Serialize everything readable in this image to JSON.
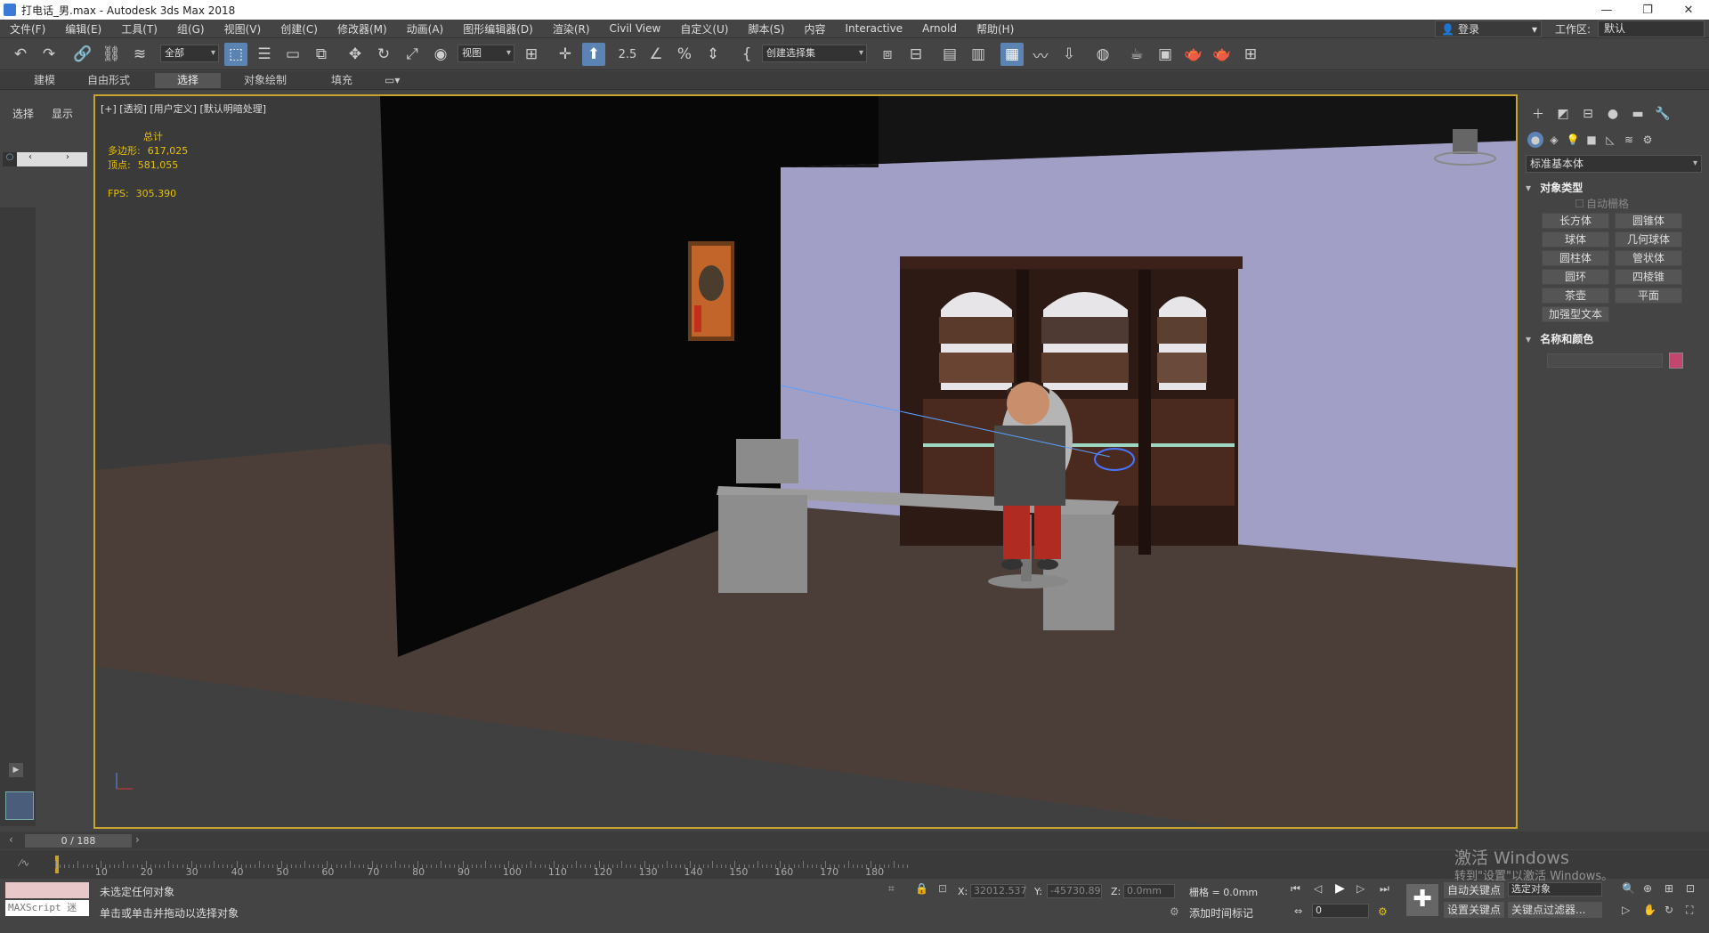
{
  "window": {
    "title": "打电话_男.max - Autodesk 3ds Max 2018",
    "minimize_icon": "minimize-icon",
    "restore_icon": "restore-icon",
    "close_icon": "close-icon"
  },
  "menubar": {
    "items": [
      "文件(F)",
      "编辑(E)",
      "工具(T)",
      "组(G)",
      "视图(V)",
      "创建(C)",
      "修改器(M)",
      "动画(A)",
      "图形编辑器(D)",
      "渲染(R)",
      "Civil View",
      "自定义(U)",
      "脚本(S)",
      "内容",
      "Interactive",
      "Arnold",
      "帮助(H)"
    ],
    "login": "登录",
    "workspace_label": "工作区:",
    "workspace_value": "默认"
  },
  "toolbar": {
    "selection_filter": "全部",
    "ref_coord": "视图",
    "named_selection": "创建选择集",
    "snap_label": "2.5"
  },
  "ribbon": {
    "tabs": [
      "建模",
      "自由形式",
      "选择",
      "对象绘制",
      "填充"
    ],
    "active_tab": "选择"
  },
  "leftpanel": {
    "tab_select": "选择",
    "tab_display": "显示"
  },
  "viewport": {
    "label": "[+] [透视] [用户定义] [默认明暗处理]",
    "stats": {
      "total_label": "总计",
      "polys_label": "多边形:",
      "polys_value": "617,025",
      "verts_label": "顶点:",
      "verts_value": "581,055",
      "fps_label": "FPS:",
      "fps_value": "305.390"
    }
  },
  "cmdpanel": {
    "category": "标准基本体",
    "object_type_title": "对象类型",
    "autogrid": "自动栅格",
    "buttons": [
      "长方体",
      "圆锥体",
      "球体",
      "几何球体",
      "圆柱体",
      "管状体",
      "圆环",
      "四棱锥",
      "茶壶",
      "平面",
      "加强型文本"
    ],
    "name_color_title": "名称和颜色",
    "color_swatch": "#c2466e"
  },
  "timeline": {
    "frame_display": "0 / 188",
    "ticks": [
      "10",
      "20",
      "30",
      "40",
      "50",
      "60",
      "70",
      "80",
      "90",
      "100",
      "110",
      "120",
      "130",
      "140",
      "150",
      "160",
      "170",
      "180"
    ]
  },
  "status": {
    "maxscript": "MAXScript 迷",
    "line1": "未选定任何对象",
    "line2": "单击或单击并拖动以选择对象",
    "x_label": "X:",
    "x_value": "32012.537",
    "y_label": "Y:",
    "y_value": "-45730.89",
    "z_label": "Z:",
    "z_value": "0.0mm",
    "grid": "栅格 = 0.0mm",
    "add_time_tag": "添加时间标记",
    "auto_key": "自动关键点",
    "set_key": "设置关键点",
    "selected_object": "选定对象",
    "key_filter": "关键点过滤器...",
    "frame_field": "0",
    "watermark1": "激活 Windows",
    "watermark2": "转到\"设置\"以激活 Windows。"
  }
}
